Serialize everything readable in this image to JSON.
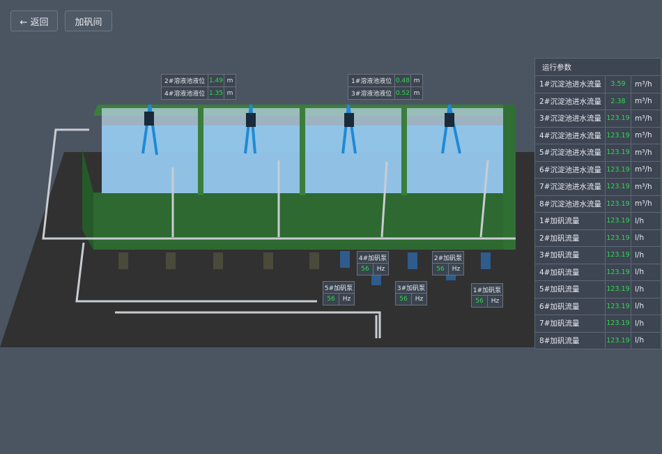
{
  "toolbar": {
    "back_label": "← 返回",
    "dosing_label": "加矾间"
  },
  "level_panels": [
    {
      "rows": [
        {
          "name": "2#溶液池液位",
          "value": "1.49",
          "unit": "m"
        },
        {
          "name": "4#溶液池液位",
          "value": "1.35",
          "unit": "m"
        }
      ]
    },
    {
      "rows": [
        {
          "name": "1#溶液池液位",
          "value": "0.48",
          "unit": "m"
        },
        {
          "name": "3#溶液池液位",
          "value": "0.52",
          "unit": "m"
        }
      ]
    }
  ],
  "pumps": [
    {
      "name": "4#加矾泵",
      "value": "56",
      "unit": "Hz"
    },
    {
      "name": "2#加矾泵",
      "value": "56",
      "unit": "Hz"
    },
    {
      "name": "5#加矾泵",
      "value": "56",
      "unit": "Hz"
    },
    {
      "name": "3#加矾泵",
      "value": "56",
      "unit": "Hz"
    },
    {
      "name": "1#加矾泵",
      "value": "56",
      "unit": "Hz"
    }
  ],
  "params": {
    "title": "运行参数",
    "rows": [
      {
        "name": "1#沉淀池进水流量",
        "value": "3.59",
        "unit": "m³/h"
      },
      {
        "name": "2#沉淀池进水流量",
        "value": "2.38",
        "unit": "m³/h"
      },
      {
        "name": "3#沉淀池进水流量",
        "value": "123.19",
        "unit": "m³/h"
      },
      {
        "name": "4#沉淀池进水流量",
        "value": "123.19",
        "unit": "m³/h"
      },
      {
        "name": "5#沉淀池进水流量",
        "value": "123.19",
        "unit": "m³/h"
      },
      {
        "name": "6#沉淀池进水流量",
        "value": "123.19",
        "unit": "m³/h"
      },
      {
        "name": "7#沉淀池进水流量",
        "value": "123.19",
        "unit": "m³/h"
      },
      {
        "name": "8#沉淀池进水流量",
        "value": "123.19",
        "unit": "m³/h"
      },
      {
        "name": "1#加矾流量",
        "value": "123.19",
        "unit": "l/h"
      },
      {
        "name": "2#加矾流量",
        "value": "123.19",
        "unit": "l/h"
      },
      {
        "name": "3#加矾流量",
        "value": "123.19",
        "unit": "l/h"
      },
      {
        "name": "4#加矾流量",
        "value": "123.19",
        "unit": "l/h"
      },
      {
        "name": "5#加矾流量",
        "value": "123.19",
        "unit": "l/h"
      },
      {
        "name": "6#加矾流量",
        "value": "123.19",
        "unit": "l/h"
      },
      {
        "name": "7#加矾流量",
        "value": "123.19",
        "unit": "l/h"
      },
      {
        "name": "8#加矾流量",
        "value": "123.19",
        "unit": "l/h"
      }
    ]
  },
  "colors": {
    "background": "#4b5461",
    "value_green": "#30d94f",
    "tank_green": "#2f6f33",
    "water": "#8ec6ec"
  }
}
